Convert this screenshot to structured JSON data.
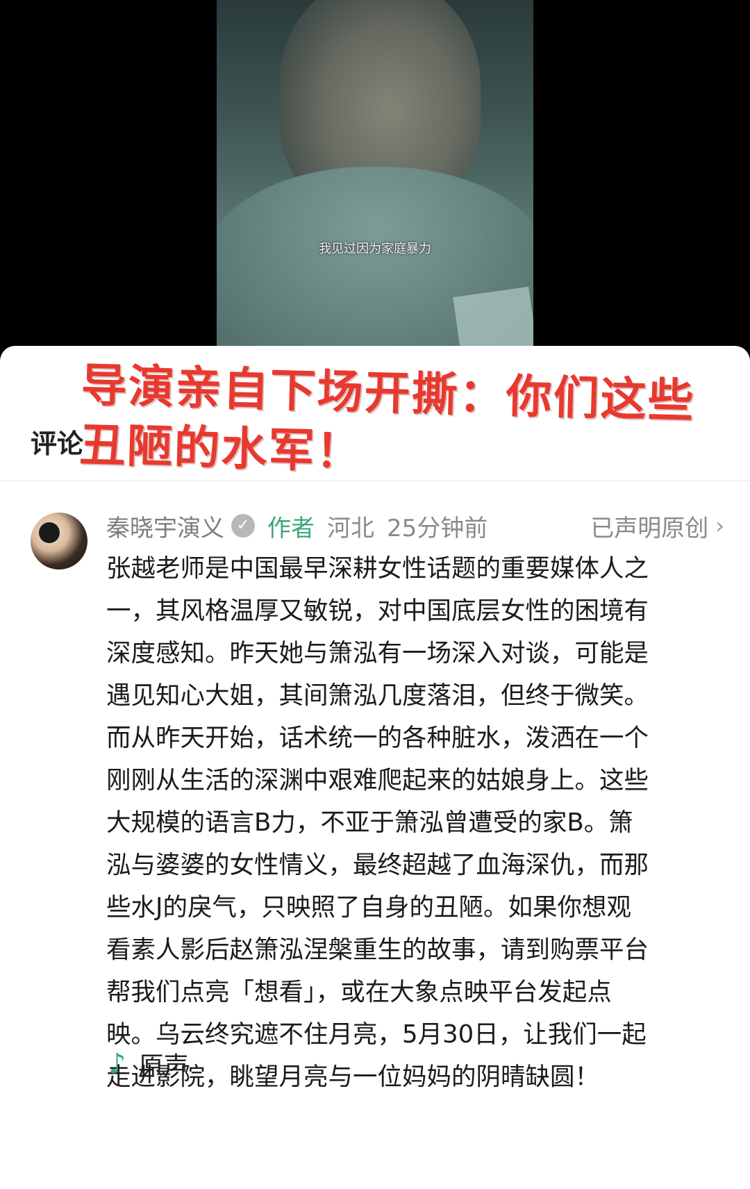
{
  "video": {
    "subtitle": "我见过因为家庭暴力"
  },
  "panel": {
    "comment_label": "评论",
    "headline": "导演亲自下场开撕：你们这些丑陋的水军！"
  },
  "comment": {
    "username": "秦晓宇演义",
    "author_tag": "作者",
    "location": "河北",
    "time": "25分钟前",
    "declared": "已声明原创",
    "body": "张越老师是中国最早深耕女性话题的重要媒体人之\n一，其风格温厚又敏锐，对中国底层女性的困境有\n深度感知。昨天她与箫泓有一场深入对谈，可能是\n遇见知心大姐，其间箫泓几度落泪，但终于微笑。\n而从昨天开始，话术统一的各种脏水，泼洒在一个\n刚刚从生活的深渊中艰难爬起来的姑娘身上。这些\n大规模的语言B力，不亚于箫泓曾遭受的家B。箫\n泓与婆婆的女性情义，最终超越了血海深仇，而那\n些水J的戾气，只映照了自身的丑陋。如果你想观\n看素人影后赵箫泓涅槃重生的故事，请到购票平台\n帮我们点亮「想看」，或在大象点映平台发起点\n映。乌云终究遮不住月亮，5月30日，让我们一起\n走进影院，眺望月亮与一位妈妈的阴晴缺圆！",
    "music_label": "原声"
  },
  "icons": {
    "verified": "verified-badge-icon",
    "chevron": "chevron-right-icon",
    "music": "music-note-icon"
  },
  "colors": {
    "headline": "#e8392f",
    "author_tag": "#3aa876",
    "music_icon": "#3aa876"
  }
}
